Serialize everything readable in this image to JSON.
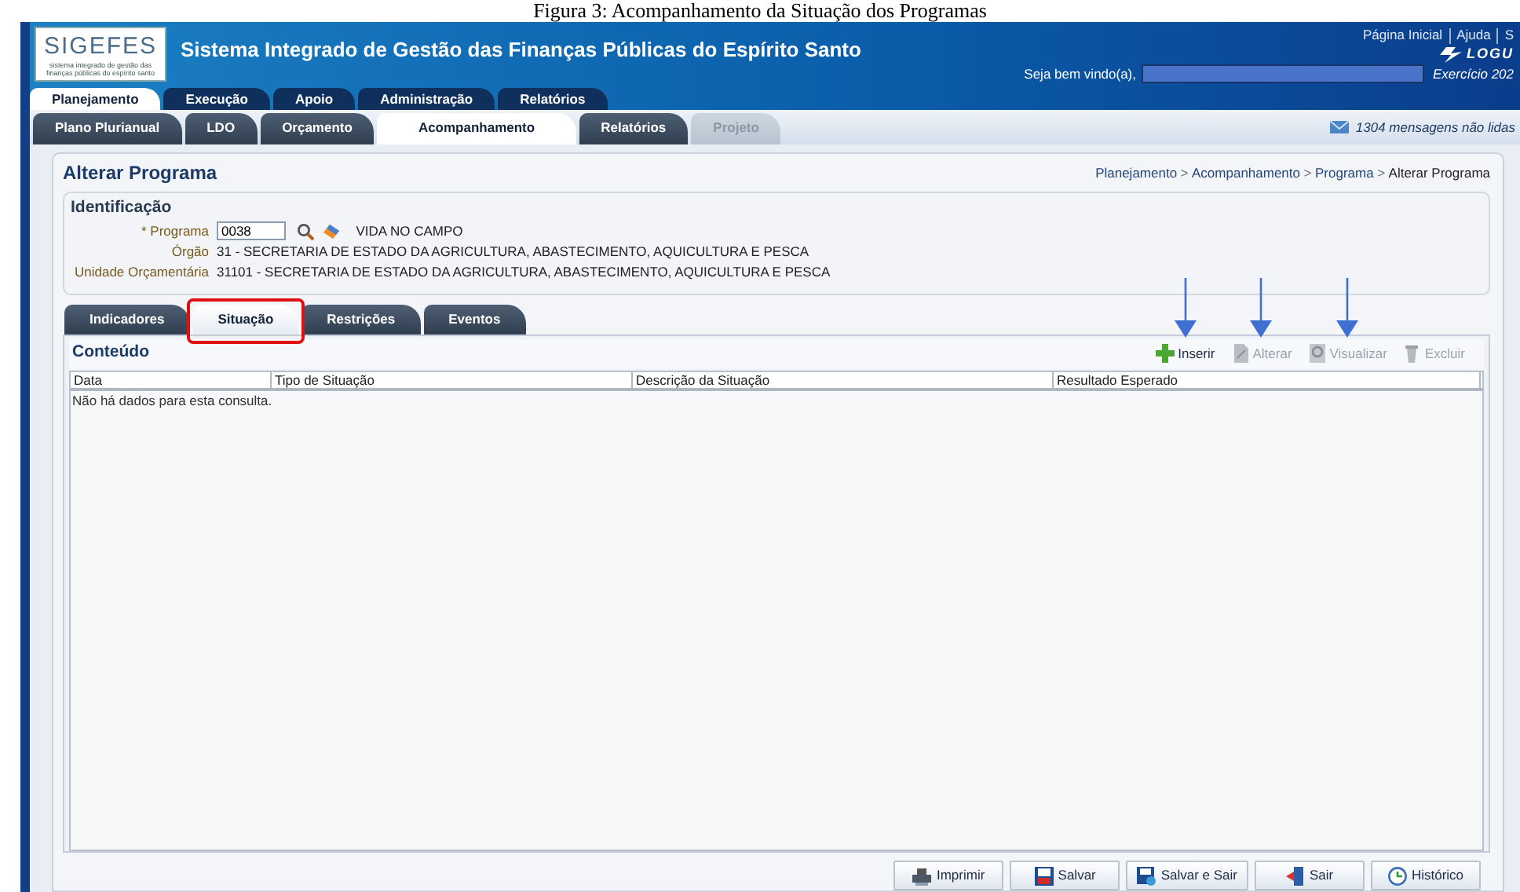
{
  "caption": "Figura 3: Acompanhamento da Situação dos Programas",
  "header": {
    "logo": "SIGEFES",
    "logo_subtitle": "sistema integrado de gestão das finanças públicas do espírito santo",
    "title": "Sistema Integrado de Gestão das Finanças Públicas do Espírito Santo",
    "links": [
      "Página Inicial",
      "Ajuda",
      "S"
    ],
    "vendor_logo": "LOGU",
    "welcome": "Seja bem vindo(a),",
    "exercise": "Exercício 202"
  },
  "main_tabs": [
    {
      "label": "Planejamento",
      "selected": true
    },
    {
      "label": "Execução",
      "selected": false
    },
    {
      "label": "Apoio",
      "selected": false
    },
    {
      "label": "Administração",
      "selected": false
    },
    {
      "label": "Relatórios",
      "selected": false
    }
  ],
  "sub_tabs": [
    {
      "label": "Plano Plurianual",
      "selected": false,
      "disabled": false
    },
    {
      "label": "LDO",
      "selected": false,
      "disabled": false
    },
    {
      "label": "Orçamento",
      "selected": false,
      "disabled": false
    },
    {
      "label": "Acompanhamento",
      "selected": true,
      "disabled": false
    },
    {
      "label": "Relatórios",
      "selected": false,
      "disabled": false
    },
    {
      "label": "Projeto",
      "selected": false,
      "disabled": true
    }
  ],
  "messages": "1304 mensagens não lidas",
  "page": {
    "title": "Alterar Programa",
    "breadcrumb_separator": ">",
    "breadcrumb": [
      {
        "label": "Planejamento",
        "current": false
      },
      {
        "label": "Acompanhamento",
        "current": false
      },
      {
        "label": "Programa",
        "current": false
      },
      {
        "label": "Alterar Programa",
        "current": true
      }
    ]
  },
  "identification": {
    "title": "Identificação",
    "fields": [
      {
        "label": "* Programa",
        "kind": "lookup",
        "value": "0038",
        "description": "VIDA NO CAMPO"
      },
      {
        "label": "Órgão",
        "kind": "text",
        "value": "31 - SECRETARIA DE ESTADO DA AGRICULTURA, ABASTECIMENTO, AQUICULTURA E PESCA"
      },
      {
        "label": "Unidade Orçamentária",
        "kind": "text",
        "value": "31101 - SECRETARIA DE ESTADO DA AGRICULTURA, ABASTECIMENTO, AQUICULTURA E PESCA"
      }
    ]
  },
  "detail_tabs": [
    {
      "label": "Indicadores",
      "selected": false,
      "highlighted": false
    },
    {
      "label": "Situação",
      "selected": true,
      "highlighted": true
    },
    {
      "label": "Restrições",
      "selected": false,
      "highlighted": false
    },
    {
      "label": "Eventos",
      "selected": false,
      "highlighted": false
    }
  ],
  "content": {
    "title": "Conteúdo",
    "actions": [
      {
        "label": "Inserir",
        "kind": "insert",
        "disabled": false,
        "arrow": true
      },
      {
        "label": "Alterar",
        "kind": "edit",
        "disabled": true,
        "arrow": true
      },
      {
        "label": "Visualizar",
        "kind": "view",
        "disabled": true,
        "arrow": true
      },
      {
        "label": "Excluir",
        "kind": "delete",
        "disabled": true,
        "arrow": false
      }
    ],
    "columns": [
      "Data",
      "Tipo de Situação",
      "Descrição da Situação",
      "Resultado Esperado"
    ],
    "empty_message": "Não há dados para esta consulta."
  },
  "footer_buttons": [
    {
      "label": "Imprimir",
      "kind": "print"
    },
    {
      "label": "Salvar",
      "kind": "save"
    },
    {
      "label": "Salvar e Sair",
      "kind": "save-exit"
    },
    {
      "label": "Sair",
      "kind": "exit"
    },
    {
      "label": "Histórico",
      "kind": "history"
    }
  ]
}
